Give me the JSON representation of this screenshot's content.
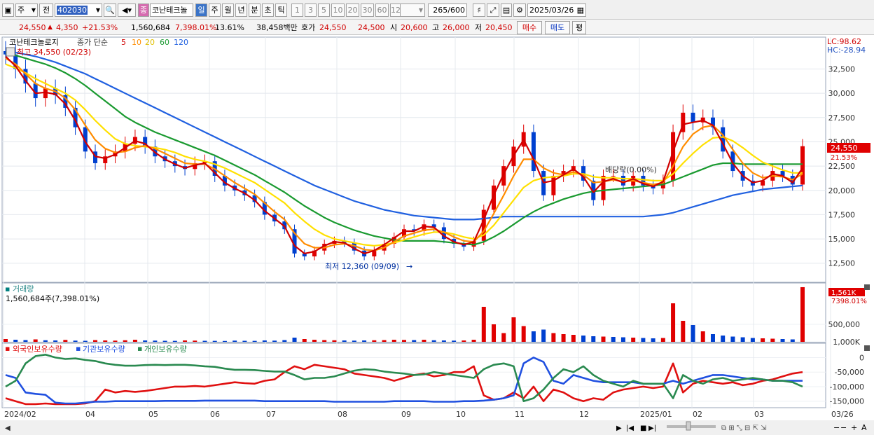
{
  "toolbar": {
    "market_label": "주",
    "prev_label": "전",
    "code_value": "402030",
    "stock_name": "코난테크놀",
    "period_tabs": [
      "일",
      "주",
      "월",
      "년",
      "분",
      "초",
      "틱"
    ],
    "interval_buttons": [
      "1",
      "3",
      "5",
      "10",
      "20",
      "30",
      "60",
      "120"
    ],
    "count_value": "265",
    "count_total": "/600",
    "date_value": "2025/03/26"
  },
  "info": {
    "price": "24,550",
    "change": "4,350",
    "change_pct": "+21.53%",
    "volume": "1,560,684",
    "vol_pct": "7,398.01%",
    "turnover": "13.61%",
    "amount": "38,458백만",
    "quote_label": "호가",
    "ask": "24,550",
    "bid": "24,500",
    "open_label": "시",
    "open": "20,600",
    "high_label": "고",
    "high": "26,000",
    "low_label": "저",
    "low": "20,450",
    "buy_label": "매수",
    "sell_label": "매도",
    "avg_label": "평"
  },
  "legend": {
    "title": "코난테크놀로지",
    "ma_label": "종가 단순",
    "ma_periods": [
      "5",
      "10",
      "20",
      "60",
      "120"
    ],
    "high_note": "최고 34,550 (02/23)",
    "low_note": "최저 12,360 (09/09)",
    "dividend_note": "배당락(0.00%)",
    "lc": "LC:98.62",
    "hc": "HC:-28.94",
    "price_tag": "24,550",
    "pct_tag": "21.53%"
  },
  "volume_panel": {
    "title": "거래량",
    "value": "1,560,684주(7,398.01%)",
    "tag": "1,561K",
    "tag_pct": "7398.01%"
  },
  "holdings_panel": {
    "legend": [
      "외국인보유수량",
      "기관보유수량",
      "개인보유수량"
    ]
  },
  "colors": {
    "up": "#e00000",
    "down": "#0040d0",
    "ma5": "#d00000",
    "ma10": "#ff8c00",
    "ma20": "#ffe000",
    "ma60": "#1a9a30",
    "ma120": "#2060e0",
    "foreign": "#e01010",
    "institution": "#2050e0",
    "individual": "#2a8a50"
  },
  "chart_data": [
    {
      "type": "candlestick",
      "x_ticks": [
        "2024/02",
        "04",
        "05",
        "06",
        "07",
        "08",
        "09",
        "10",
        "11",
        "12",
        "2025/01",
        "02",
        "03",
        "03/26"
      ],
      "y_ticks": [
        "32,500",
        "30,000",
        "27,500",
        "25,000",
        "22,500",
        "20,000",
        "17,500",
        "15,000",
        "12,500"
      ],
      "ylim": [
        10750,
        34700
      ],
      "closes": [
        34000,
        32500,
        31000,
        29500,
        30500,
        29800,
        28500,
        26500,
        24000,
        22800,
        23500,
        24000,
        24800,
        25500,
        24500,
        23500,
        23000,
        22500,
        22200,
        22800,
        23000,
        21500,
        20500,
        20000,
        19500,
        18800,
        17500,
        16800,
        16000,
        13500,
        13200,
        13800,
        14500,
        14800,
        14600,
        13800,
        13200,
        13800,
        14500,
        15200,
        16000,
        15800,
        16500,
        16200,
        15000,
        14500,
        14200,
        14800,
        18000,
        20500,
        22500,
        24500,
        26000,
        22000,
        19500,
        21500,
        22000,
        22500,
        21000,
        19000,
        21500,
        21500,
        20500,
        21500,
        20500,
        20200,
        21000,
        26000,
        28000,
        27000,
        27500,
        26500,
        24000,
        22000,
        21000,
        20500,
        21000,
        22000,
        21500,
        20600,
        24550
      ],
      "ma5": [
        33800,
        32800,
        31300,
        30000,
        30100,
        29900,
        28900,
        27200,
        25000,
        23500,
        23300,
        23700,
        24400,
        25100,
        24800,
        23900,
        23200,
        22700,
        22300,
        22600,
        22800,
        21800,
        20800,
        20200,
        19700,
        19000,
        17900,
        17100,
        16300,
        14300,
        13500,
        13700,
        14300,
        14700,
        14600,
        14000,
        13500,
        13800,
        14400,
        15100,
        15800,
        15800,
        16300,
        16200,
        15300,
        14700,
        14400,
        14700,
        17000,
        19500,
        21700,
        23600,
        25200,
        23200,
        20800,
        21000,
        21600,
        22200,
        21400,
        19800,
        20900,
        21200,
        20800,
        21200,
        20700,
        20400,
        20900,
        24000,
        26800,
        27000,
        27200,
        26700,
        24800,
        22800,
        21500,
        20800,
        21000,
        21700,
        21500,
        20800,
        22300
      ],
      "ma10": [
        33600,
        33000,
        32000,
        31000,
        30500,
        30200,
        29500,
        28300,
        26700,
        25200,
        24300,
        23900,
        24000,
        24400,
        24600,
        24300,
        23800,
        23300,
        22800,
        22700,
        22700,
        22200,
        21500,
        20800,
        20200,
        19600,
        18700,
        17800,
        17000,
        15600,
        14500,
        14100,
        14100,
        14400,
        14500,
        14300,
        13900,
        13800,
        14100,
        14700,
        15300,
        15600,
        15900,
        16000,
        15700,
        15200,
        14800,
        14700,
        15800,
        17600,
        19500,
        21500,
        23200,
        23200,
        22300,
        21800,
        21600,
        21900,
        21600,
        20800,
        20900,
        21100,
        20900,
        21000,
        20800,
        20600,
        20800,
        22500,
        24500,
        25800,
        26500,
        26700,
        25700,
        24200,
        22800,
        21800,
        21300,
        21500,
        21400,
        21100,
        21700
      ],
      "ma20": [
        33000,
        32600,
        32100,
        31500,
        31000,
        30500,
        30000,
        29300,
        28300,
        27200,
        26200,
        25300,
        24800,
        24600,
        24500,
        24400,
        24200,
        23900,
        23500,
        23200,
        23000,
        22700,
        22300,
        21800,
        21300,
        20800,
        20100,
        19400,
        18700,
        17700,
        16800,
        16000,
        15400,
        15000,
        14800,
        14600,
        14400,
        14300,
        14400,
        14600,
        14900,
        15200,
        15500,
        15700,
        15700,
        15500,
        15200,
        15000,
        15400,
        16400,
        17700,
        19000,
        20300,
        21000,
        21300,
        21400,
        21500,
        21700,
        21700,
        21400,
        21300,
        21300,
        21200,
        21200,
        21100,
        21000,
        21000,
        21700,
        22800,
        23800,
        24700,
        25400,
        25500,
        25100,
        24400,
        23600,
        22900,
        22500,
        22100,
        21800,
        21800
      ],
      "ma60": [
        34200,
        33900,
        33600,
        33300,
        33000,
        32600,
        32100,
        31500,
        30800,
        30000,
        29200,
        28400,
        27600,
        27000,
        26500,
        26000,
        25600,
        25200,
        24800,
        24400,
        24000,
        23600,
        23100,
        22600,
        22100,
        21600,
        21000,
        20400,
        19800,
        19100,
        18400,
        17800,
        17200,
        16700,
        16300,
        15900,
        15600,
        15300,
        15100,
        14900,
        14800,
        14800,
        14800,
        14800,
        14700,
        14600,
        14500,
        14400,
        14700,
        15200,
        15800,
        16500,
        17200,
        17800,
        18300,
        18700,
        19100,
        19400,
        19700,
        19900,
        20000,
        20100,
        20200,
        20300,
        20400,
        20500,
        20600,
        21000,
        21400,
        21800,
        22200,
        22600,
        22800,
        22800,
        22700,
        22700,
        22700,
        22700,
        22700,
        22700,
        22700
      ],
      "ma120": [
        34300,
        34200,
        34000,
        33800,
        33500,
        33200,
        32800,
        32400,
        32000,
        31500,
        31000,
        30500,
        30000,
        29500,
        29000,
        28500,
        28000,
        27500,
        27000,
        26500,
        26000,
        25500,
        25000,
        24500,
        24000,
        23500,
        23000,
        22500,
        22000,
        21500,
        21000,
        20500,
        20100,
        19700,
        19300,
        18900,
        18600,
        18300,
        18000,
        17800,
        17600,
        17400,
        17300,
        17200,
        17100,
        17000,
        17000,
        17000,
        17100,
        17200,
        17300,
        17300,
        17300,
        17300,
        17300,
        17300,
        17300,
        17300,
        17300,
        17300,
        17300,
        17300,
        17300,
        17300,
        17300,
        17400,
        17500,
        17700,
        18000,
        18300,
        18600,
        18900,
        19200,
        19500,
        19700,
        19900,
        20100,
        20200,
        20300,
        20400,
        20500
      ]
    },
    {
      "type": "bar",
      "title": "거래량",
      "y_ticks": [
        "1,000K",
        "500,000"
      ],
      "ylim": [
        0,
        1600000
      ],
      "values": [
        80000,
        60000,
        50000,
        70000,
        45000,
        40000,
        55000,
        35000,
        30000,
        50000,
        40000,
        35000,
        45000,
        60000,
        40000,
        35000,
        30000,
        28000,
        40000,
        35000,
        30000,
        28000,
        25000,
        35000,
        30000,
        28000,
        40000,
        35000,
        50000,
        120000,
        80000,
        60000,
        50000,
        45000,
        40000,
        35000,
        40000,
        45000,
        50000,
        60000,
        55000,
        50000,
        60000,
        45000,
        40000,
        35000,
        40000,
        60000,
        1000000,
        500000,
        250000,
        700000,
        450000,
        300000,
        350000,
        250000,
        220000,
        200000,
        180000,
        160000,
        150000,
        140000,
        130000,
        120000,
        110000,
        100000,
        110000,
        1100000,
        600000,
        480000,
        300000,
        220000,
        180000,
        150000,
        130000,
        110000,
        100000,
        90000,
        80000,
        70000,
        1560684
      ],
      "up": [
        true,
        false,
        false,
        true,
        false,
        false,
        true,
        false,
        false,
        true,
        true,
        true,
        true,
        true,
        false,
        false,
        false,
        false,
        true,
        true,
        false,
        false,
        false,
        false,
        false,
        false,
        false,
        false,
        false,
        false,
        true,
        true,
        true,
        true,
        false,
        false,
        false,
        true,
        true,
        true,
        true,
        false,
        true,
        false,
        false,
        false,
        true,
        true,
        true,
        true,
        true,
        true,
        true,
        false,
        false,
        true,
        true,
        true,
        false,
        false,
        true,
        false,
        false,
        true,
        false,
        false,
        true,
        true,
        true,
        false,
        true,
        false,
        false,
        false,
        false,
        false,
        true,
        true,
        false,
        false,
        true
      ]
    },
    {
      "type": "line",
      "y_ticks": [
        "0",
        "-50,000",
        "-100,000",
        "-150,000"
      ],
      "ylim": [
        -170000,
        30000
      ],
      "series": [
        {
          "name": "외국인보유수량",
          "values": [
            -140000,
            -150000,
            -160000,
            -160000,
            -158000,
            -160000,
            -160000,
            -160000,
            -158000,
            -150000,
            -110000,
            -120000,
            -115000,
            -118000,
            -115000,
            -110000,
            -105000,
            -100000,
            -100000,
            -98000,
            -100000,
            -95000,
            -90000,
            -85000,
            -88000,
            -90000,
            -80000,
            -75000,
            -50000,
            -30000,
            -40000,
            -25000,
            -30000,
            -35000,
            -40000,
            -55000,
            -60000,
            -65000,
            -70000,
            -80000,
            -70000,
            -60000,
            -55000,
            -65000,
            -60000,
            -50000,
            -50000,
            -30000,
            -130000,
            -145000,
            -140000,
            -120000,
            -140000,
            -100000,
            -150000,
            -110000,
            -120000,
            -140000,
            -150000,
            -140000,
            -145000,
            -120000,
            -110000,
            -105000,
            -100000,
            -105000,
            -100000,
            -20000,
            -120000,
            -90000,
            -80000,
            -85000,
            -90000,
            -85000,
            -95000,
            -90000,
            -80000,
            -75000,
            -65000,
            -55000,
            -50000
          ]
        },
        {
          "name": "기관보유수량",
          "values": [
            -60000,
            -70000,
            -120000,
            -125000,
            -128000,
            -155000,
            -158000,
            -158000,
            -155000,
            -152000,
            -152000,
            -150000,
            -150000,
            -150000,
            -150000,
            -150000,
            -149000,
            -149000,
            -149000,
            -149000,
            -148000,
            -148000,
            -148000,
            -148000,
            -148000,
            -148000,
            -150000,
            -150000,
            -150000,
            -150000,
            -150000,
            -150000,
            -150000,
            -152000,
            -152000,
            -152000,
            -152000,
            -152000,
            -152000,
            -150000,
            -150000,
            -150000,
            -150000,
            -152000,
            -152000,
            -152000,
            -150000,
            -150000,
            -148000,
            -145000,
            -140000,
            -130000,
            -20000,
            0,
            -15000,
            -80000,
            -90000,
            -60000,
            -70000,
            -80000,
            -85000,
            -85000,
            -85000,
            -85000,
            -90000,
            -90000,
            -90000,
            -80000,
            -90000,
            -80000,
            -70000,
            -60000,
            -60000,
            -65000,
            -70000,
            -75000,
            -75000,
            -80000,
            -80000,
            -80000,
            -80000
          ]
        },
        {
          "name": "개인보유수량",
          "values": [
            -100000,
            -80000,
            -20000,
            5000,
            10000,
            0,
            -5000,
            -3000,
            -8000,
            -12000,
            -20000,
            -25000,
            -28000,
            -28000,
            -26000,
            -25000,
            -26000,
            -25000,
            -25000,
            -27000,
            -30000,
            -32000,
            -38000,
            -42000,
            -42000,
            -43000,
            -46000,
            -48000,
            -48000,
            -60000,
            -75000,
            -70000,
            -70000,
            -65000,
            -55000,
            -45000,
            -40000,
            -42000,
            -48000,
            -52000,
            -55000,
            -60000,
            -58000,
            -50000,
            -55000,
            -60000,
            -65000,
            -70000,
            -40000,
            -25000,
            -20000,
            -30000,
            -150000,
            -140000,
            -110000,
            -70000,
            -40000,
            -50000,
            -30000,
            -60000,
            -80000,
            -90000,
            -100000,
            -80000,
            -90000,
            -90000,
            -90000,
            -140000,
            -60000,
            -80000,
            -90000,
            -75000,
            -70000,
            -80000,
            -75000,
            -70000,
            -75000,
            -80000,
            -80000,
            -85000,
            -100000
          ]
        }
      ]
    }
  ]
}
